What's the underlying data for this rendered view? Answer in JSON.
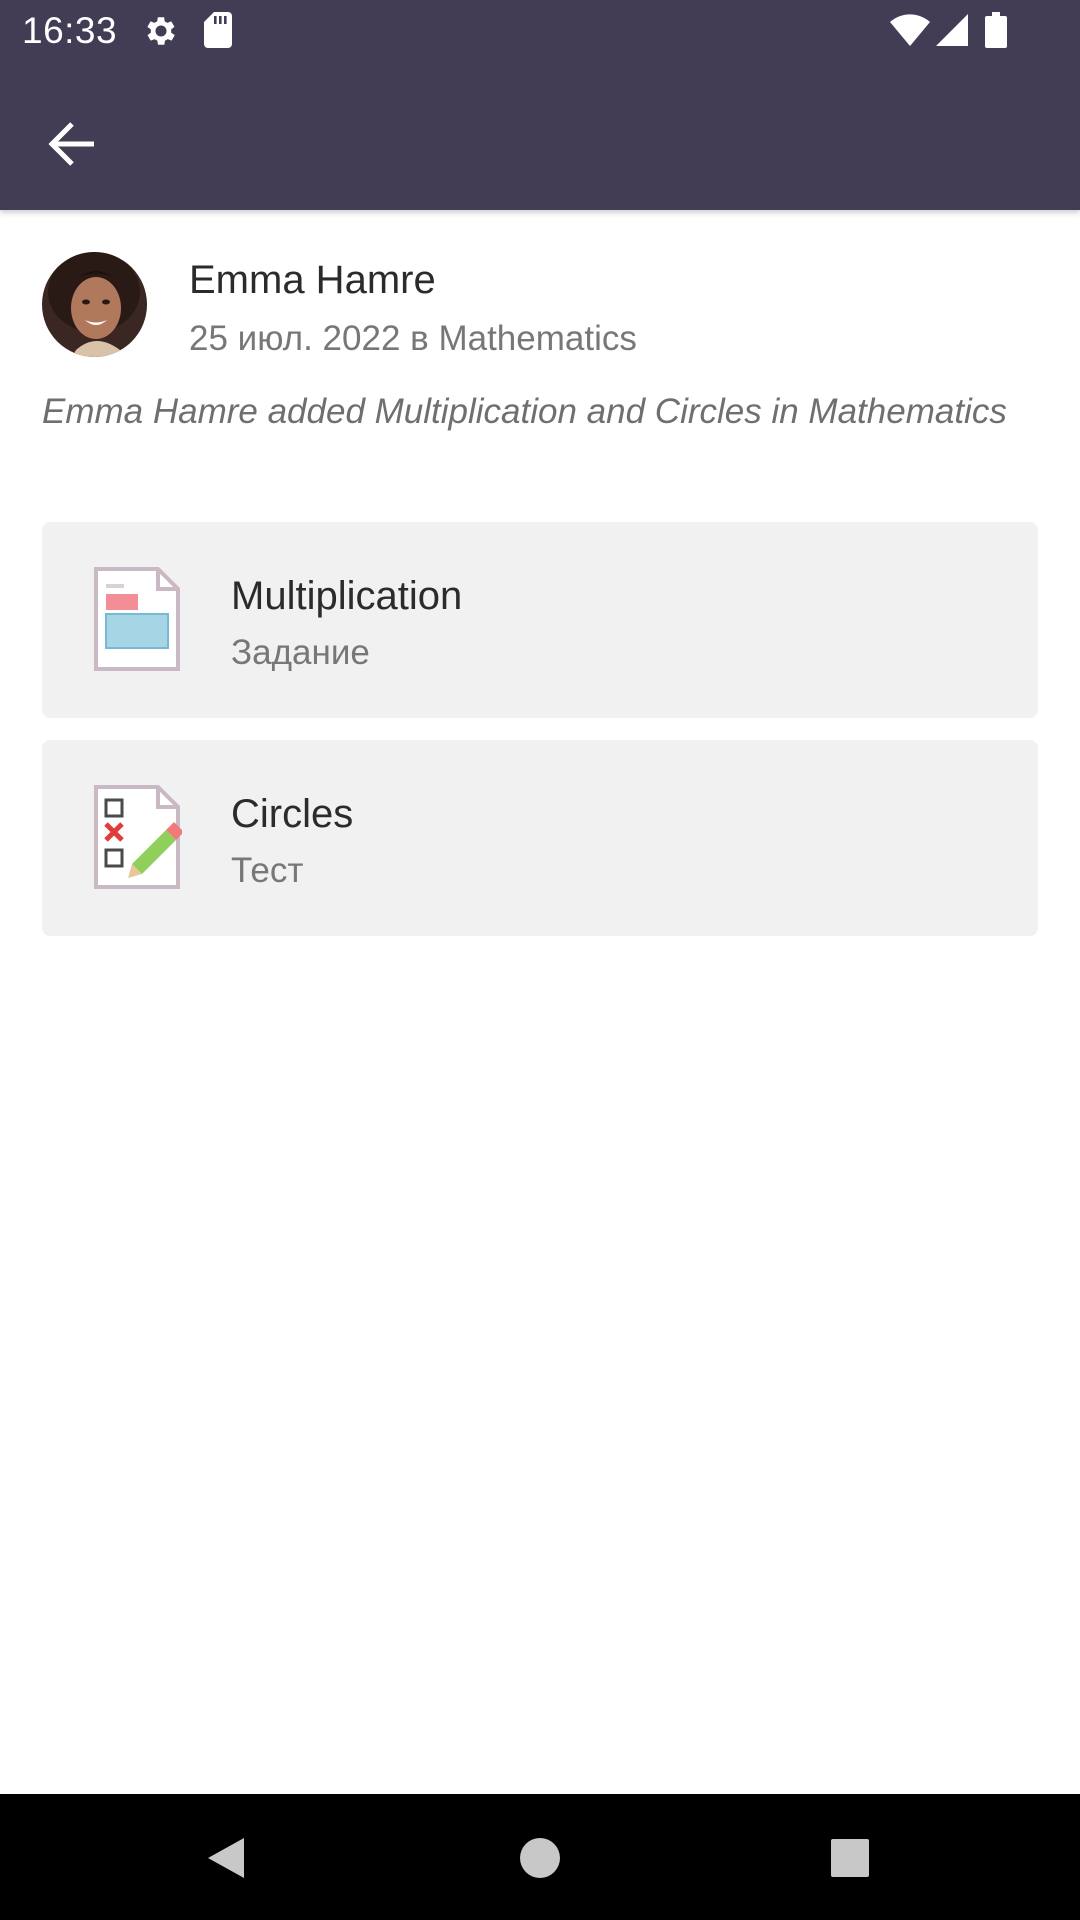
{
  "status_bar": {
    "time": "16:33",
    "icons": [
      "gear-icon",
      "sd-card-icon",
      "wifi-icon",
      "signal-icon",
      "battery-icon"
    ]
  },
  "app_bar": {
    "back_icon": "arrow-left-icon",
    "color": "#423d55"
  },
  "post": {
    "author": "Emma Hamre",
    "meta": "25 июл. 2022 в Mathematics",
    "description": "Emma Hamre added Multiplication and Circles in Mathematics"
  },
  "items": [
    {
      "title": "Multiplication",
      "subtitle": "Задание",
      "icon": "assignment-icon"
    },
    {
      "title": "Circles",
      "subtitle": "Тест",
      "icon": "test-checklist-icon"
    }
  ],
  "nav_bar": {
    "buttons": [
      "back-triangle-icon",
      "home-circle-icon",
      "recents-square-icon"
    ]
  }
}
